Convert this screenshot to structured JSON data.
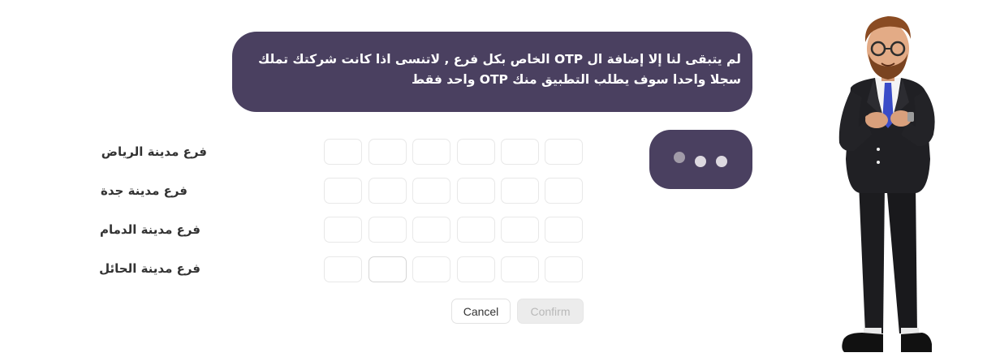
{
  "message": {
    "text": "لم يتبقى لنا إلا إضافة ال OTP الخاص بكل فرع , لاتنسى اذا كانت شركتك تملك سجلا واحدا سوف يطلب التطبيق منك OTP واحد فقط"
  },
  "typing_indicator": {
    "dots": 3
  },
  "branches": [
    {
      "label": "فرع مدينة الرياض"
    },
    {
      "label": "فرع مدينة جدة"
    },
    {
      "label": "فرع مدينة الدمام"
    },
    {
      "label": "فرع مدينة الحائل"
    }
  ],
  "otp": {
    "digits_per_branch": 6
  },
  "buttons": {
    "cancel": "Cancel",
    "confirm": "Confirm"
  },
  "colors": {
    "bubble": "#4a4060",
    "bubble_text": "#ffffff",
    "confirm_disabled_bg": "#ececec",
    "confirm_disabled_text": "#b9b9b9"
  }
}
